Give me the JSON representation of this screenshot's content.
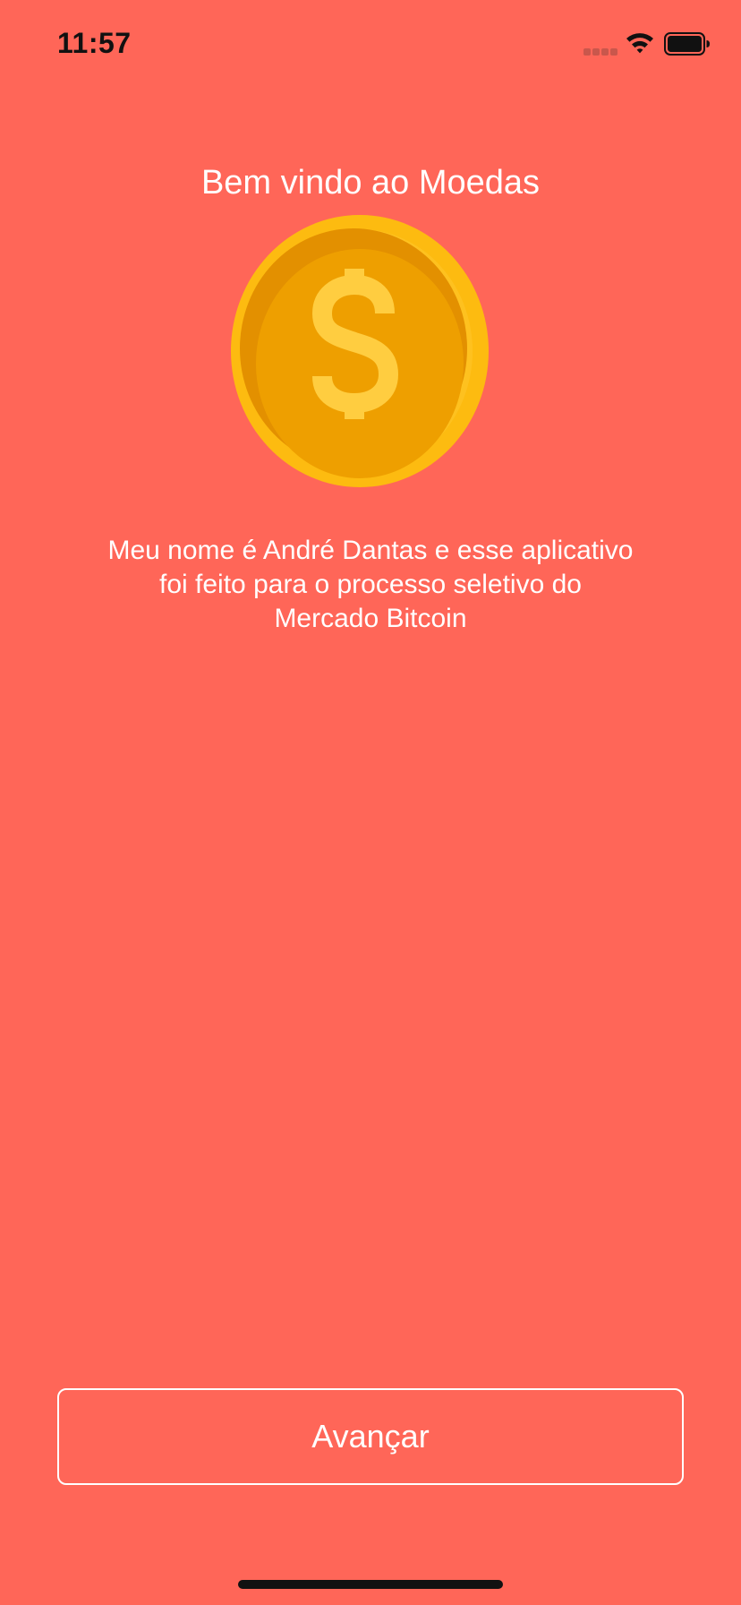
{
  "status_bar": {
    "time": "11:57"
  },
  "welcome": {
    "title": "Bem vindo ao Moedas",
    "description_lines": [
      "Meu nome é André Dantas e esse aplicativo",
      "foi feito para o processo seletivo do",
      "Mercado Bitcoin"
    ],
    "icon": "coin-dollar-icon"
  },
  "actions": {
    "next_label": "Avançar"
  },
  "colors": {
    "background": "#FF6658",
    "coin_outer": "#FDBB10",
    "coin_inner": "#EE9F00",
    "dollar_sign": "#FFCD40"
  }
}
